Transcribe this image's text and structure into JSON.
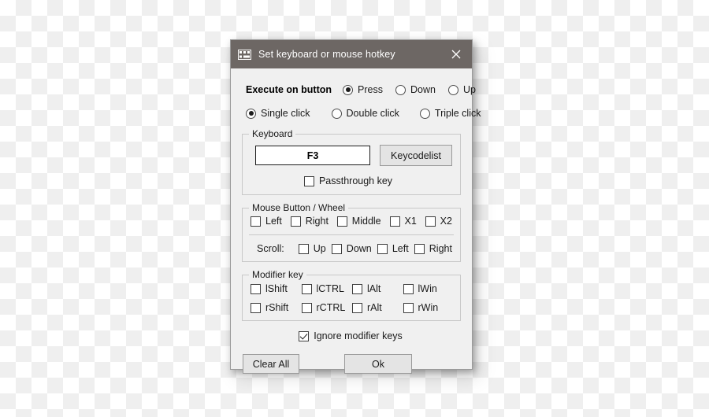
{
  "window": {
    "title": "Set keyboard or mouse hotkey",
    "icon": "keyboard-icon",
    "close_icon": "close-icon",
    "titlebar_color": "#6d6764",
    "body_color": "#f0f0f0"
  },
  "execute_on_button": {
    "label": "Execute on button",
    "options": [
      {
        "label": "Press",
        "selected": true
      },
      {
        "label": "Down",
        "selected": false
      },
      {
        "label": "Up",
        "selected": false
      }
    ]
  },
  "click_type": {
    "options": [
      {
        "label": "Single click",
        "selected": true
      },
      {
        "label": "Double click",
        "selected": false
      },
      {
        "label": "Triple click",
        "selected": false
      }
    ]
  },
  "keyboard": {
    "legend": "Keyboard",
    "key_value": "F3",
    "keycodelist_label": "Keycodelist",
    "passthrough": {
      "label": "Passthrough key",
      "checked": false
    }
  },
  "mouse": {
    "legend": "Mouse Button / Wheel",
    "buttons": [
      {
        "label": "Left",
        "checked": false
      },
      {
        "label": "Right",
        "checked": false
      },
      {
        "label": "Middle",
        "checked": false
      },
      {
        "label": "X1",
        "checked": false
      },
      {
        "label": "X2",
        "checked": false
      }
    ],
    "scroll_label": "Scroll:",
    "scroll": [
      {
        "label": "Up",
        "checked": false
      },
      {
        "label": "Down",
        "checked": false
      },
      {
        "label": "Left",
        "checked": false
      },
      {
        "label": "Right",
        "checked": false
      }
    ]
  },
  "modifier": {
    "legend": "Modifier key",
    "keys": [
      {
        "label": "lShift",
        "checked": false
      },
      {
        "label": "lCTRL",
        "checked": false
      },
      {
        "label": "lAlt",
        "checked": false
      },
      {
        "label": "lWin",
        "checked": false
      },
      {
        "label": "rShift",
        "checked": false
      },
      {
        "label": "rCTRL",
        "checked": false
      },
      {
        "label": "rAlt",
        "checked": false
      },
      {
        "label": "rWin",
        "checked": false
      }
    ],
    "ignore": {
      "label": "Ignore modifier keys",
      "checked": true
    }
  },
  "footer": {
    "clear_all_label": "Clear All",
    "ok_label": "Ok"
  }
}
